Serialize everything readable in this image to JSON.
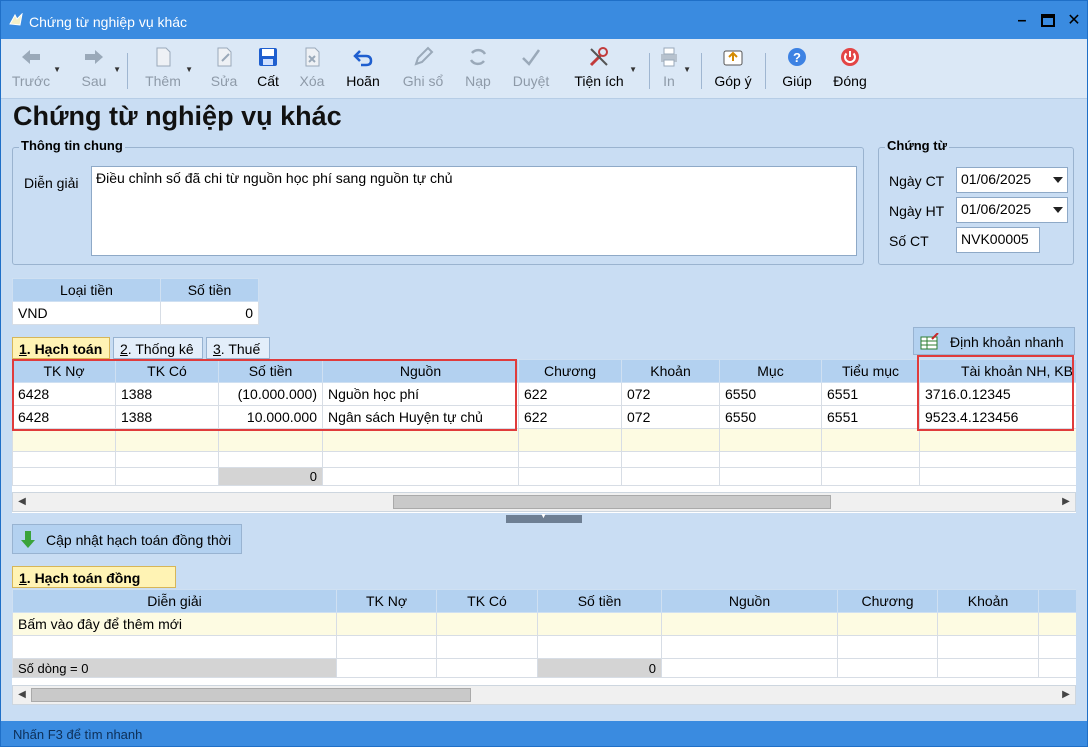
{
  "window": {
    "title": "Chứng từ nghiệp vụ khác"
  },
  "toolbar": {
    "items": [
      {
        "label": "Trước",
        "icon": "arrow-left-icon"
      },
      {
        "label": "Sau",
        "icon": "arrow-right-icon"
      },
      {
        "label": "Thêm",
        "icon": "new-document-icon"
      },
      {
        "label": "Sửa",
        "icon": "edit-document-icon"
      },
      {
        "label": "Cất",
        "icon": "save-icon"
      },
      {
        "label": "Xóa",
        "icon": "delete-document-icon"
      },
      {
        "label": "Hoãn",
        "icon": "undo-icon"
      },
      {
        "label": "Ghi sổ",
        "icon": "pencil-icon"
      },
      {
        "label": "Nạp",
        "icon": "refresh-icon"
      },
      {
        "label": "Duyệt",
        "icon": "checkmark-icon"
      },
      {
        "label": "Tiện ích",
        "icon": "tools-icon"
      },
      {
        "label": "In",
        "icon": "printer-icon"
      },
      {
        "label": "Góp ý",
        "icon": "feedback-icon"
      },
      {
        "label": "Giúp",
        "icon": "help-icon"
      },
      {
        "label": "Đóng",
        "icon": "power-icon"
      }
    ]
  },
  "page_title": "Chứng từ nghiệp vụ khác",
  "general": {
    "legend": "Thông tin chung",
    "desc_label": "Diễn giải",
    "desc_value": "Điều chỉnh số đã chi từ nguồn học phí sang nguồn tự chủ"
  },
  "voucher": {
    "legend": "Chứng từ",
    "date_ct_label": "Ngày CT",
    "date_ct_value": "01/06/2025",
    "date_ht_label": "Ngày HT",
    "date_ht_value": "01/06/2025",
    "so_ct_label": "Số CT",
    "so_ct_value": "NVK00005"
  },
  "currency": {
    "headers": [
      "Loại tiền",
      "Số tiền"
    ],
    "type": "VND",
    "amount": "0"
  },
  "tabs": [
    {
      "key": "1",
      "label": ". Hạch toán"
    },
    {
      "key": "2",
      "label": ". Thống kê"
    },
    {
      "key": "3",
      "label": ". Thuế"
    }
  ],
  "quick_entry_button": "Định khoản nhanh",
  "main_grid": {
    "headers": [
      "TK Nợ",
      "TK Có",
      "Số tiền",
      "Nguồn",
      "Chương",
      "Khoản",
      "Mục",
      "Tiểu mục",
      "Tài khoản NH, KB"
    ],
    "rows": [
      [
        "6428",
        "1388",
        "(10.000.000)",
        "Nguồn học phí",
        "622",
        "072",
        "6550",
        "6551",
        "3716.0.12345"
      ],
      [
        "6428",
        "1388",
        "10.000.000",
        "Ngân sách Huyện tự chủ",
        "622",
        "072",
        "6550",
        "6551",
        "9523.4.123456"
      ]
    ],
    "total": "0"
  },
  "update_button": "Cập nhật hạch toán đồng thời",
  "tab2": {
    "key": "1",
    "label": ". Hạch toán đồng thời"
  },
  "grid2": {
    "headers": [
      "Diễn giải",
      "TK Nợ",
      "TK Có",
      "Số tiền",
      "Nguồn",
      "Chương",
      "Khoản"
    ],
    "add_hint": "Bấm vào đây để thêm mới",
    "row_count": "Số dòng = 0",
    "total": "0"
  },
  "status": "Nhấn F3 để tìm nhanh"
}
